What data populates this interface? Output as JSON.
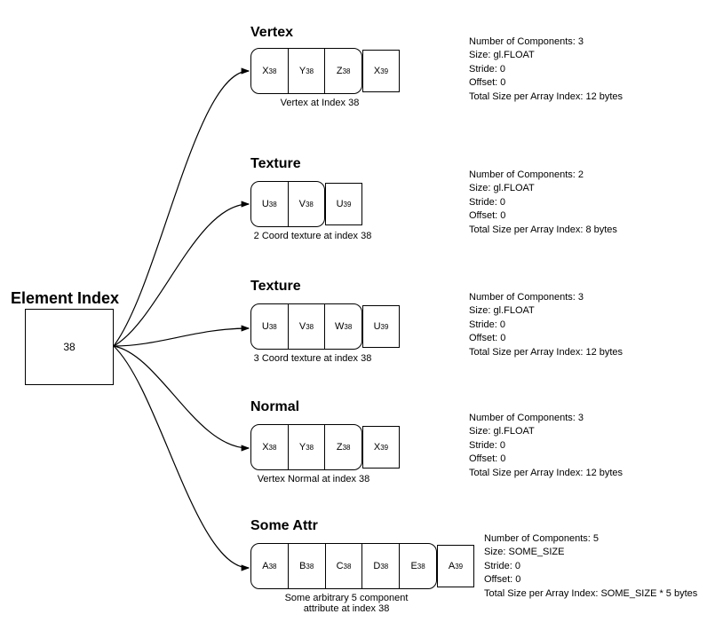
{
  "elementIndex": {
    "title": "Element Index",
    "value": "38"
  },
  "attributes": [
    {
      "title": "Vertex",
      "cells": [
        "X",
        "Y",
        "Z"
      ],
      "sub": "38",
      "overflow": "X",
      "overflowSub": "39",
      "caption": "Vertex at Index 38",
      "meta": {
        "components": "Number of Components: 3",
        "size": "Size: gl.FLOAT",
        "stride": "Stride: 0",
        "offset": "Offset: 0",
        "total": "Total Size per Array Index: 12 bytes"
      }
    },
    {
      "title": "Texture",
      "cells": [
        "U",
        "V"
      ],
      "sub": "38",
      "overflow": "U",
      "overflowSub": "39",
      "caption": "2 Coord texture at index 38",
      "meta": {
        "components": "Number of Components: 2",
        "size": "Size: gl.FLOAT",
        "stride": "Stride: 0",
        "offset": "Offset: 0",
        "total": "Total Size per Array Index: 8 bytes"
      }
    },
    {
      "title": "Texture",
      "cells": [
        "U",
        "V",
        "W"
      ],
      "sub": "38",
      "overflow": "U",
      "overflowSub": "39",
      "caption": "3 Coord texture at index 38",
      "meta": {
        "components": "Number of Components: 3",
        "size": "Size: gl.FLOAT",
        "stride": "Stride: 0",
        "offset": "Offset: 0",
        "total": "Total Size per Array Index: 12 bytes"
      }
    },
    {
      "title": "Normal",
      "cells": [
        "X",
        "Y",
        "Z"
      ],
      "sub": "38",
      "overflow": "X",
      "overflowSub": "39",
      "caption": "Vertex Normal at index 38",
      "meta": {
        "components": "Number of Components: 3",
        "size": "Size: gl.FLOAT",
        "stride": "Stride: 0",
        "offset": "Offset: 0",
        "total": "Total Size per Array Index: 12 bytes"
      }
    },
    {
      "title": "Some Attr",
      "cells": [
        "A",
        "B",
        "C",
        "D",
        "E"
      ],
      "sub": "38",
      "overflow": "A",
      "overflowSub": "39",
      "caption": "Some arbitrary 5 component\nattribute at index 38",
      "meta": {
        "components": "Number of Components: 5",
        "size": "Size: SOME_SIZE",
        "stride": "Stride: 0",
        "offset": "Offset: 0",
        "total": "Total Size per Array Index: SOME_SIZE * 5 bytes"
      }
    }
  ]
}
